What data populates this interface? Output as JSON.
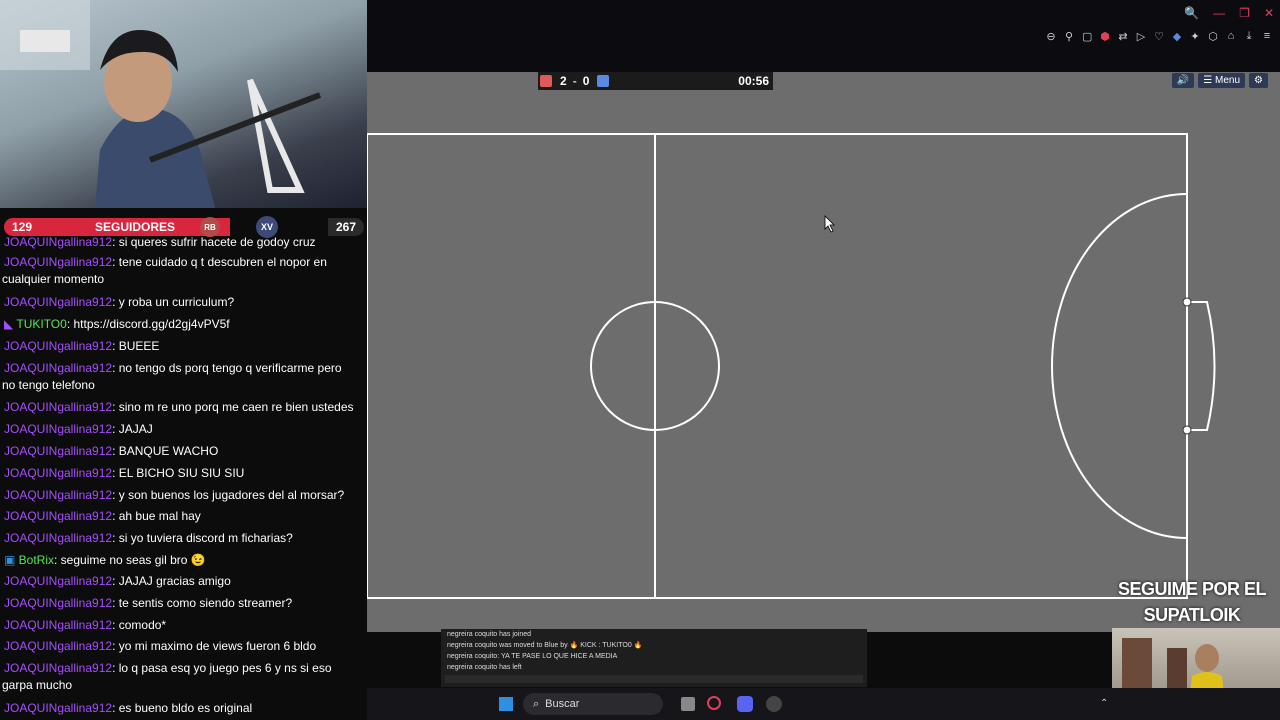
{
  "window_controls": [
    "🔍",
    "—",
    "❐",
    "✕"
  ],
  "toolbar_icons": [
    "zoom-out",
    "pin",
    "box",
    "shield",
    "translate",
    "play",
    "heart",
    "extension",
    "puzzle",
    "share",
    "profile",
    "download",
    "more"
  ],
  "scoreboard": {
    "red_score": "2",
    "separator": "-",
    "blue_score": "0",
    "time": "00:56",
    "red_color": "#e05a5a",
    "blue_color": "#5a8ae0"
  },
  "menu_bar": {
    "sound": "🔊",
    "menu_label": "☰ Menu",
    "settings": "⚙"
  },
  "followers": {
    "left_count": "129",
    "label": "SEGUIDORES",
    "right_count": "267",
    "badge_left": "RB",
    "badge_right": "XV"
  },
  "chat": [
    {
      "user": "JOAQUINgallina912",
      "text": ": si queres sufrir hacete de godoy cruz"
    },
    {
      "user": "JOAQUINgallina912",
      "text": ": tene cuidado q t descubren el nopor en",
      "cont": "cualquier momento"
    },
    {
      "user": "JOAQUINgallina912",
      "text": ": y roba un curriculum?"
    },
    {
      "user": "TUKITO0",
      "text": ": https://discord.gg/d2gj4vPV5f",
      "user_color": "#55e655"
    },
    {
      "user": "JOAQUINgallina912",
      "text": ": BUEEE"
    },
    {
      "user": "JOAQUINgallina912",
      "text": ": no tengo ds porq tengo q verificarme pero",
      "cont": "no tengo telefono"
    },
    {
      "user": "JOAQUINgallina912",
      "text": ": sino m re uno porq me caen re bien ustedes"
    },
    {
      "user": "JOAQUINgallina912",
      "text": ": JAJAJ"
    },
    {
      "user": "JOAQUINgallina912",
      "text": ": BANQUE WACHO"
    },
    {
      "user": "JOAQUINgallina912",
      "text": ": EL BICHO SIU SIU SIU"
    },
    {
      "user": "JOAQUINgallina912",
      "text": ": y son buenos los jugadores del al morsar?"
    },
    {
      "user": "JOAQUINgallina912",
      "text": ": ah bue mal hay"
    },
    {
      "user": "JOAQUINgallina912",
      "text": ": si yo tuviera discord m ficharias?"
    },
    {
      "user": "BotRix",
      "text": ": seguime no seas gil bro 😉",
      "user_color": "#55e655"
    },
    {
      "user": "JOAQUINgallina912",
      "text": ": JAJAJ gracias amigo"
    },
    {
      "user": "JOAQUINgallina912",
      "text": ": te sentis como siendo streamer?"
    },
    {
      "user": "JOAQUINgallina912",
      "text": ": comodo*"
    },
    {
      "user": "JOAQUINgallina912",
      "text": ": yo mi maximo de views fueron 6 bldo"
    },
    {
      "user": "JOAQUINgallina912",
      "text": ": lo q pasa esq yo juego pes 6 y ns si eso",
      "cont": "garpa mucho"
    },
    {
      "user": "JOAQUINgallina912",
      "text": ": es bueno bldo es original"
    }
  ],
  "promo": {
    "line1": "SEGUIME POR EL",
    "line2": "SUPATLOIK BAILARIN"
  },
  "gamelog": [
    "negreira coquito has joined",
    "negreira coquito was moved to Blue by 🔥 KICK : TUKITO0 🔥",
    "negreira coquito: YA TE PASE LO QUE HICE A MEDIA",
    "negreira coquito has left"
  ],
  "taskbar": {
    "search_label": "Buscar",
    "start_color": "#2f8fe0"
  }
}
